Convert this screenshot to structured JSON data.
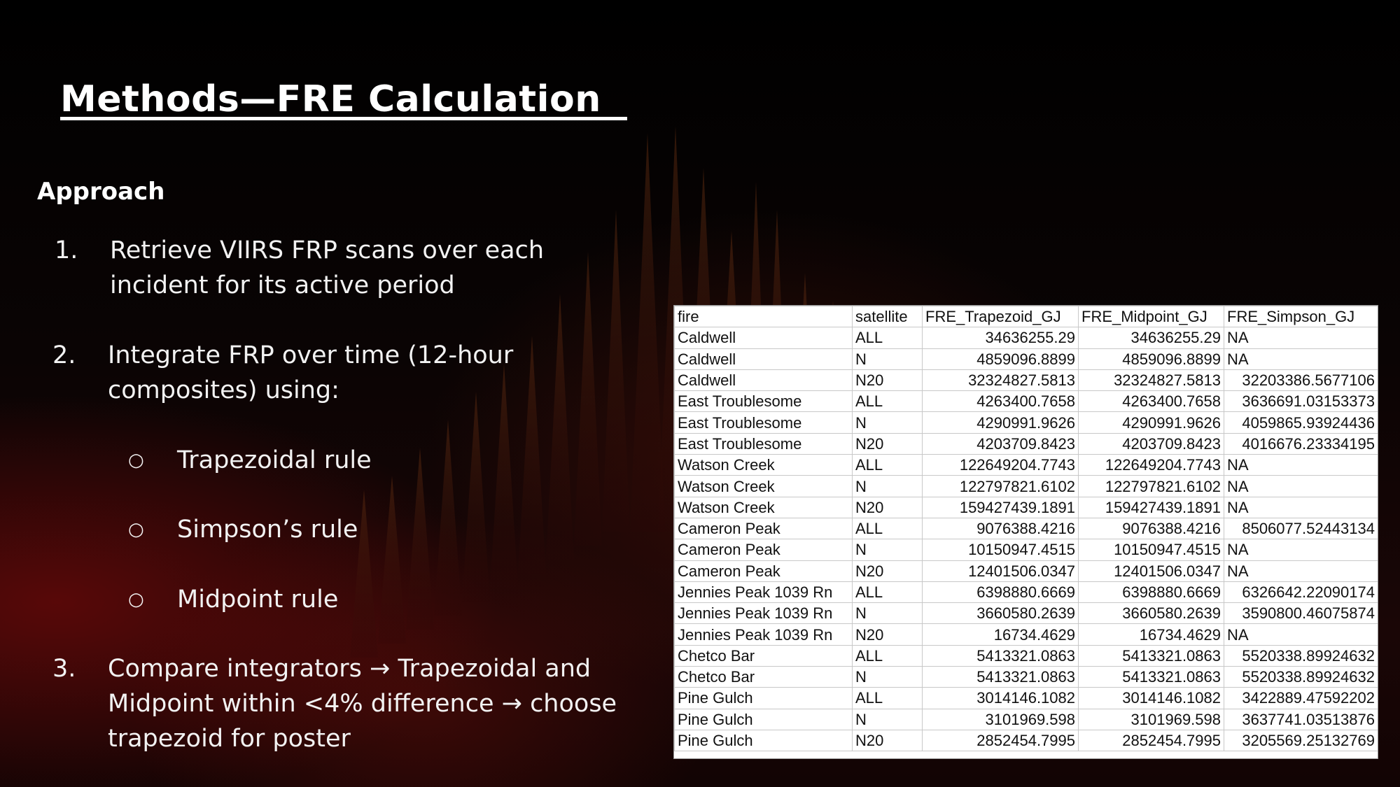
{
  "slide": {
    "title": "Methods—FRE Calculation  ",
    "subheading": "Approach",
    "steps": [
      {
        "number": "1.",
        "text": "Retrieve VIIRS FRP scans over each incident for its active period"
      },
      {
        "number": "2.",
        "text": "Integrate FRP over time (12-hour composites) using:"
      },
      {
        "number": "3.",
        "text": "Compare integrators → Trapezoidal and Midpoint within <4% difference → choose trapezoid for poster"
      }
    ],
    "bullets": [
      {
        "mark": "○",
        "text": "Trapezoidal rule"
      },
      {
        "mark": "○",
        "text": "Simpson’s rule"
      },
      {
        "mark": "○",
        "text": "Midpoint rule"
      }
    ]
  },
  "table": {
    "columns": [
      "fire",
      "satellite",
      "FRE_Trapezoid_GJ",
      "FRE_Midpoint_GJ",
      "FRE_Simpson_GJ"
    ],
    "rows": [
      [
        "Caldwell",
        "ALL",
        "34636255.29",
        "34636255.29",
        "NA"
      ],
      [
        "Caldwell",
        "N",
        "4859096.8899",
        "4859096.8899",
        "NA"
      ],
      [
        "Caldwell",
        "N20",
        "32324827.5813",
        "32324827.5813",
        "32203386.5677106"
      ],
      [
        "East Troublesome",
        "ALL",
        "4263400.7658",
        "4263400.7658",
        "3636691.03153373"
      ],
      [
        "East Troublesome",
        "N",
        "4290991.9626",
        "4290991.9626",
        "4059865.93924436"
      ],
      [
        "East Troublesome",
        "N20",
        "4203709.8423",
        "4203709.8423",
        "4016676.23334195"
      ],
      [
        "Watson Creek",
        "ALL",
        "122649204.7743",
        "122649204.7743",
        "NA"
      ],
      [
        "Watson Creek",
        "N",
        "122797821.6102",
        "122797821.6102",
        "NA"
      ],
      [
        "Watson Creek",
        "N20",
        "159427439.1891",
        "159427439.1891",
        "NA"
      ],
      [
        "Cameron Peak",
        "ALL",
        "9076388.4216",
        "9076388.4216",
        "8506077.52443134"
      ],
      [
        "Cameron Peak",
        "N",
        "10150947.4515",
        "10150947.4515",
        "NA"
      ],
      [
        "Cameron Peak",
        "N20",
        "12401506.0347",
        "12401506.0347",
        "NA"
      ],
      [
        "Jennies Peak 1039 Rn",
        "ALL",
        "6398880.6669",
        "6398880.6669",
        "6326642.22090174"
      ],
      [
        "Jennies Peak 1039 Rn",
        "N",
        "3660580.2639",
        "3660580.2639",
        "3590800.46075874"
      ],
      [
        "Jennies Peak 1039 Rn",
        "N20",
        "16734.4629",
        "16734.4629",
        "NA"
      ],
      [
        "Chetco Bar",
        "ALL",
        "5413321.0863",
        "5413321.0863",
        "5520338.89924632"
      ],
      [
        "Chetco Bar",
        "N",
        "5413321.0863",
        "5413321.0863",
        "5520338.89924632"
      ],
      [
        "Pine Gulch",
        "ALL",
        "3014146.1082",
        "3014146.1082",
        "3422889.47592202"
      ],
      [
        "Pine Gulch",
        "N",
        "3101969.598",
        "3101969.598",
        "3637741.03513876"
      ],
      [
        "Pine Gulch",
        "N20",
        "2852454.7995",
        "2852454.7995",
        "3205569.25132769"
      ]
    ]
  }
}
